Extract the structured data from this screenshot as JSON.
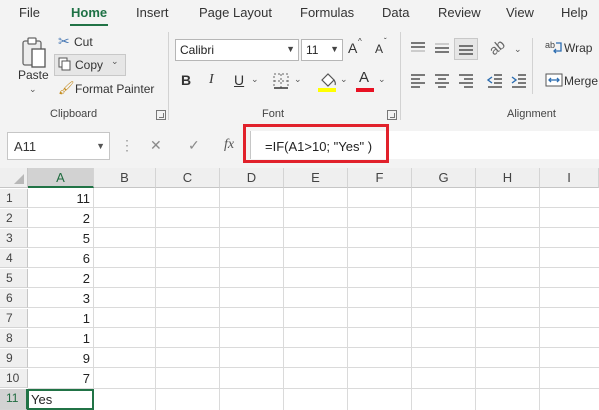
{
  "menu_tabs": [
    "File",
    "Home",
    "Insert",
    "Page Layout",
    "Formulas",
    "Data",
    "Review",
    "View",
    "Help"
  ],
  "active_tab": "Home",
  "clipboard": {
    "paste_label": "Paste",
    "cut_label": "Cut",
    "copy_label": "Copy",
    "format_painter_label": "Format Painter",
    "group_label": "Clipboard"
  },
  "font": {
    "font_name": "Calibri",
    "font_size": "11",
    "bold_label": "B",
    "italic_label": "I",
    "underline_label": "U",
    "font_color_label": "A",
    "grow_label": "A",
    "shrink_label": "A",
    "group_label": "Font",
    "fill_color": "#ffff00",
    "font_color": "#e81123"
  },
  "alignment": {
    "wrap_label": "Wrap",
    "merge_label": "Merge",
    "group_label": "Alignment"
  },
  "formula_bar": {
    "name_box": "A11",
    "fx_label": "fx",
    "formula": "=IF(A1>10; \"Yes\" )"
  },
  "columns": [
    "A",
    "B",
    "C",
    "D",
    "E",
    "F",
    "G",
    "H",
    "I"
  ],
  "rows": [
    "1",
    "2",
    "3",
    "4",
    "5",
    "6",
    "7",
    "8",
    "9",
    "10",
    "11"
  ],
  "column_a_values": [
    "11",
    "2",
    "5",
    "6",
    "2",
    "3",
    "1",
    "1",
    "9",
    "7",
    "Yes"
  ],
  "colors": {
    "accent": "#217346",
    "highlight_border": "#e1212b"
  }
}
